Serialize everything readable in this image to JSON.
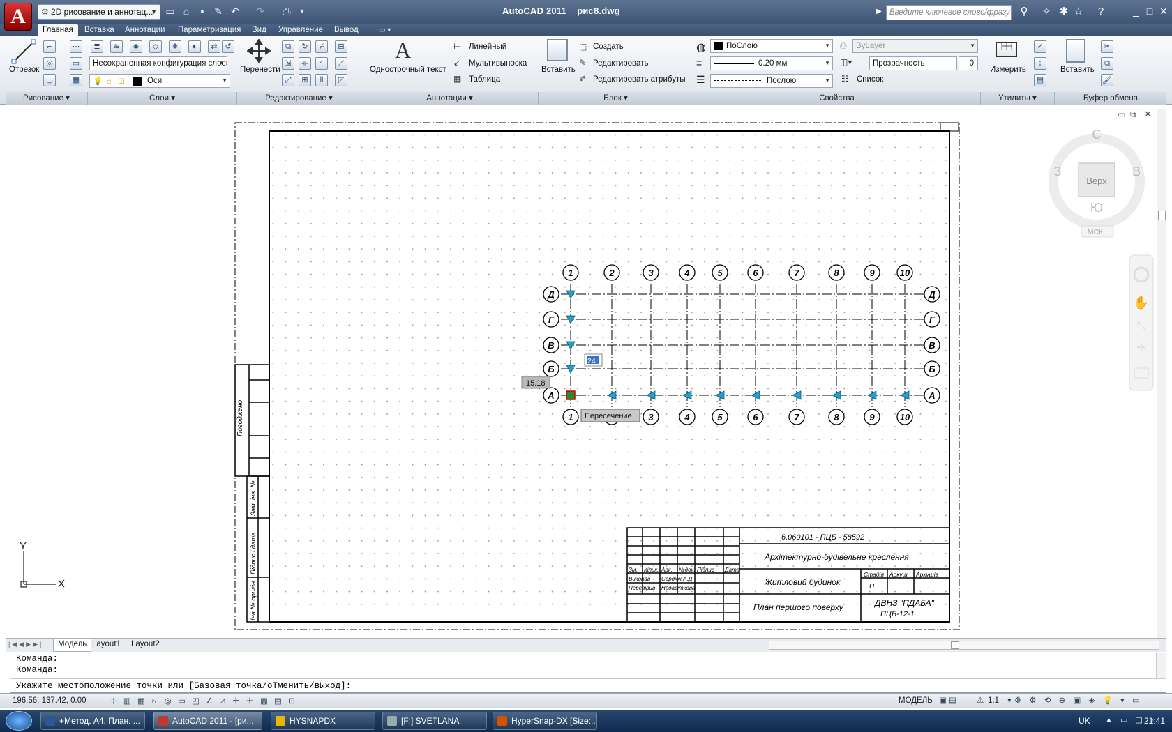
{
  "app": {
    "logo": "A",
    "title": "AutoCAD 2011    рис8.dwg",
    "workspace": "2D рисование и аннотац...",
    "search_placeholder": "Введите ключевое слово/фразу"
  },
  "ribbon_tabs": [
    "Главная",
    "Вставка",
    "Аннотации",
    "Параметризация",
    "Вид",
    "Управление",
    "Вывод"
  ],
  "ribbon": {
    "draw": {
      "title": "Рисование",
      "line": "Отрезок"
    },
    "layers": {
      "title": "Слои",
      "layer_state": "Несохраненная конфигурация слоев",
      "current_layer": "Оси"
    },
    "modify": {
      "title": "Редактирование",
      "move": "Перенести"
    },
    "annotation": {
      "title": "Аннотации",
      "text": "Однострочный текст",
      "dim": "Линейный",
      "mleader": "Мультивыноска",
      "table": "Таблица"
    },
    "block": {
      "title": "Блок",
      "insert": "Вставить",
      "create": "Создать",
      "edit": "Редактировать",
      "edit_attr": "Редактировать атрибуты"
    },
    "properties": {
      "title": "Свойства",
      "color": "ПоСлою",
      "lineweight": "0.20 мм",
      "linetype": "Послою",
      "plot_style": "ByLayer",
      "transparency_label": "Прозрачность",
      "transparency_value": "0",
      "list": "Список"
    },
    "utilities": {
      "title": "Утилиты",
      "measure": "Измерить"
    },
    "clipboard": {
      "title": "Буфер обмена",
      "paste": "Вставить"
    }
  },
  "viewcube": {
    "north": "С",
    "south": "Ю",
    "west": "З",
    "east": "В",
    "face": "Верх",
    "ucs": "МСК"
  },
  "drawing": {
    "column_labels": [
      "1",
      "2",
      "3",
      "4",
      "5",
      "6",
      "7",
      "8",
      "9",
      "10"
    ],
    "row_labels": [
      "Д",
      "Г",
      "В",
      "Б",
      "А"
    ],
    "osnap_tooltip": "Пересечение",
    "dyn_coord": "15.18",
    "dyn_input": "24",
    "ucs_y": "Y",
    "ucs_x": "X",
    "side_stamp": "Погоджено",
    "side_col1": "Зам. інв. №",
    "side_col2": "Підпис і дата",
    "side_col3": "Інв.№ оригін.",
    "title_block": {
      "code": "6.060101 - ПЦБ - 58592",
      "subject": "Архітектурно-будівельне креслення",
      "object": "Житловий будинок",
      "sheet_name": "План першого поверху",
      "org": "ДВНЗ \"ПДАБА\"",
      "group": "ПЦБ-12-1",
      "stage_h": "Стадія",
      "sheet_h": "Аркуш",
      "sheets_h": "Аркушів",
      "stage_v": "Н",
      "row_labels": [
        "Зм.",
        "Кільк.",
        "Арк.",
        "№док.",
        "Підпис",
        "Дата"
      ],
      "role1": "Виконав",
      "name1": "Сердюк А.Д",
      "role2": "Перевірив",
      "name2": "Недавіткова"
    }
  },
  "layout_tabs": [
    "Модель",
    "Layout1",
    "Layout2"
  ],
  "command_lines": [
    "Команда:",
    "Команда:",
    "Укажите местоположение точки или [Базовая точка/оТменить/вЫход]:"
  ],
  "status": {
    "coords": "196.56, 137.42, 0.00",
    "model": "МОДЕЛЬ",
    "scale": "1:1"
  },
  "taskbar": {
    "items": [
      "+Метод. А4. План. ...",
      "AutoCAD 2011 - [ри...",
      "HYSNAPDX",
      "[F:] SVETLANA",
      "HyperSnap-DX [Size:..."
    ],
    "lang": "UK",
    "time": "21:41"
  }
}
